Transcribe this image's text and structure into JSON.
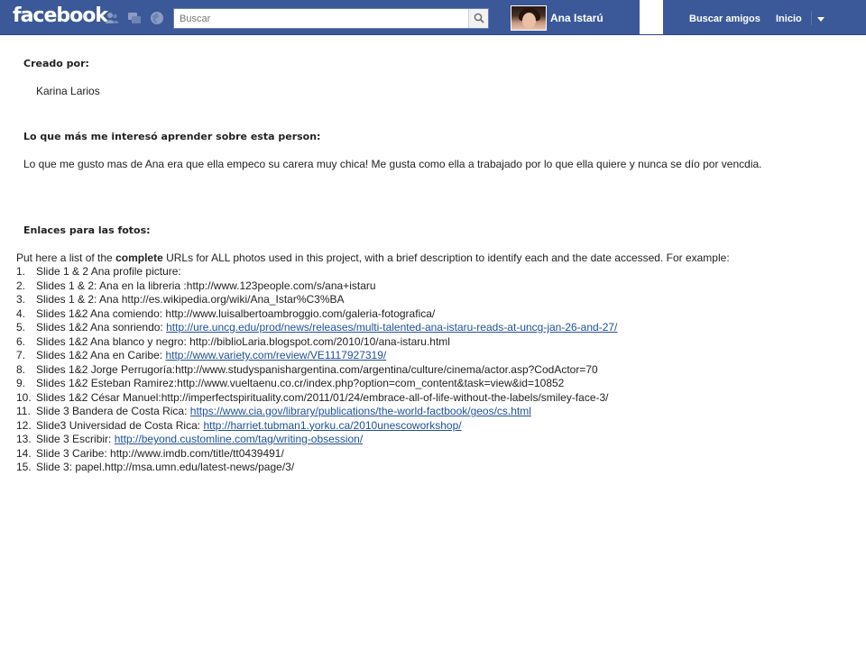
{
  "header": {
    "logo": "facebook",
    "search_placeholder": "Buscar",
    "profile_name": "Ana Istarú",
    "nav": {
      "find_friends": "Buscar amigos",
      "home": "Inicio"
    },
    "icons": [
      "friends-icon",
      "messages-icon",
      "notifications-icon",
      "search-icon",
      "account-menu-icon"
    ]
  },
  "sections": {
    "created_by": {
      "heading": "Creado por:",
      "value": "Karina Larios"
    },
    "interest": {
      "heading": "Lo que más me interesó aprender sobre esta person:",
      "text": "Lo que me gusto mas de Ana era que ella empeco su carera muy chica! Me gusta como ella a trabajado por lo que ella quiere y nunca se dío por vencdia."
    },
    "links": {
      "heading": "Enlaces para las fotos:",
      "intro_before": "Put here  a list of the ",
      "intro_bold": "complete",
      "intro_after": " URLs  for ALL photos used in this project, with a brief description to identify each and the date accessed. For example:"
    }
  },
  "url_items": [
    {
      "num": "1.",
      "text": "Slide 1 & 2 Ana profile picture:",
      "link": ""
    },
    {
      "num": "2.",
      "text": "Slides 1 & 2: Ana en la libreria :http://www.123people.com/s/ana+istaru",
      "link": ""
    },
    {
      "num": "3.",
      "text": "Slides 1 & 2: Ana  http://es.wikipedia.org/wiki/Ana_Istar%C3%BA",
      "link": ""
    },
    {
      "num": "4.",
      "text": "Slides 1&2 Ana comiendo: http://www.luisalbertoambroggio.com/galeria-fotografica/",
      "link": ""
    },
    {
      "num": "5.",
      "text": "Slides 1&2 Ana sonriendo: ",
      "link": "http://ure.uncg.edu/prod/news/releases/multi-talented-ana-istaru-reads-at-uncg-jan-26-and-27/"
    },
    {
      "num": "6.",
      "text": "Slides 1&2 Ana blanco y negro: http://biblioLaria.blogspot.com/2010/10/ana-istaru.html",
      "link": ""
    },
    {
      "num": "7.",
      "text": "Slides 1&2 Ana en Caribe: ",
      "link": "http://www.variety.com/review/VE1117927319/"
    },
    {
      "num": "8.",
      "text": "Slides 1&2 Jorge Perrugoría:http://www.studyspanishargentina.com/argentina/culture/cinema/actor.asp?CodActor=70",
      "link": ""
    },
    {
      "num": "9.",
      "text": "Slides 1&2 Esteban Ramirez:http://www.vueltaenu.co.cr/index.php?option=com_content&task=view&id=10852",
      "link": ""
    },
    {
      "num": "10.",
      "text": "Slides 1&2 César Manuel:http://imperfectspirituality.com/2011/01/24/embrace-all-of-life-without-the-labels/smiley-face-3/",
      "link": ""
    },
    {
      "num": "11.",
      "text": "Slide 3 Bandera de Costa Rica: ",
      "link": "https://www.cia.gov/library/publications/the-world-factbook/geos/cs.html"
    },
    {
      "num": "12.",
      "text": "Slide3 Universidad de Costa Rica: ",
      "link": "http://harriet.tubman1.yorku.ca/2010unescoworkshop/"
    },
    {
      "num": "13.",
      "text": "Slide 3 Escribir: ",
      "link": "http://beyond.customline.com/tag/writing-obsession/"
    },
    {
      "num": "14.",
      "text": "Slide 3 Caribe: http://www.imdb.com/title/tt0439491/",
      "link": ""
    },
    {
      "num": "15.",
      "text": "Slide 3: papel.http://msa.umn.edu/latest-news/page/3/",
      "link": ""
    }
  ],
  "colors": {
    "brand": "#3b5998",
    "link": "#1f4f99",
    "text": "#222222"
  }
}
